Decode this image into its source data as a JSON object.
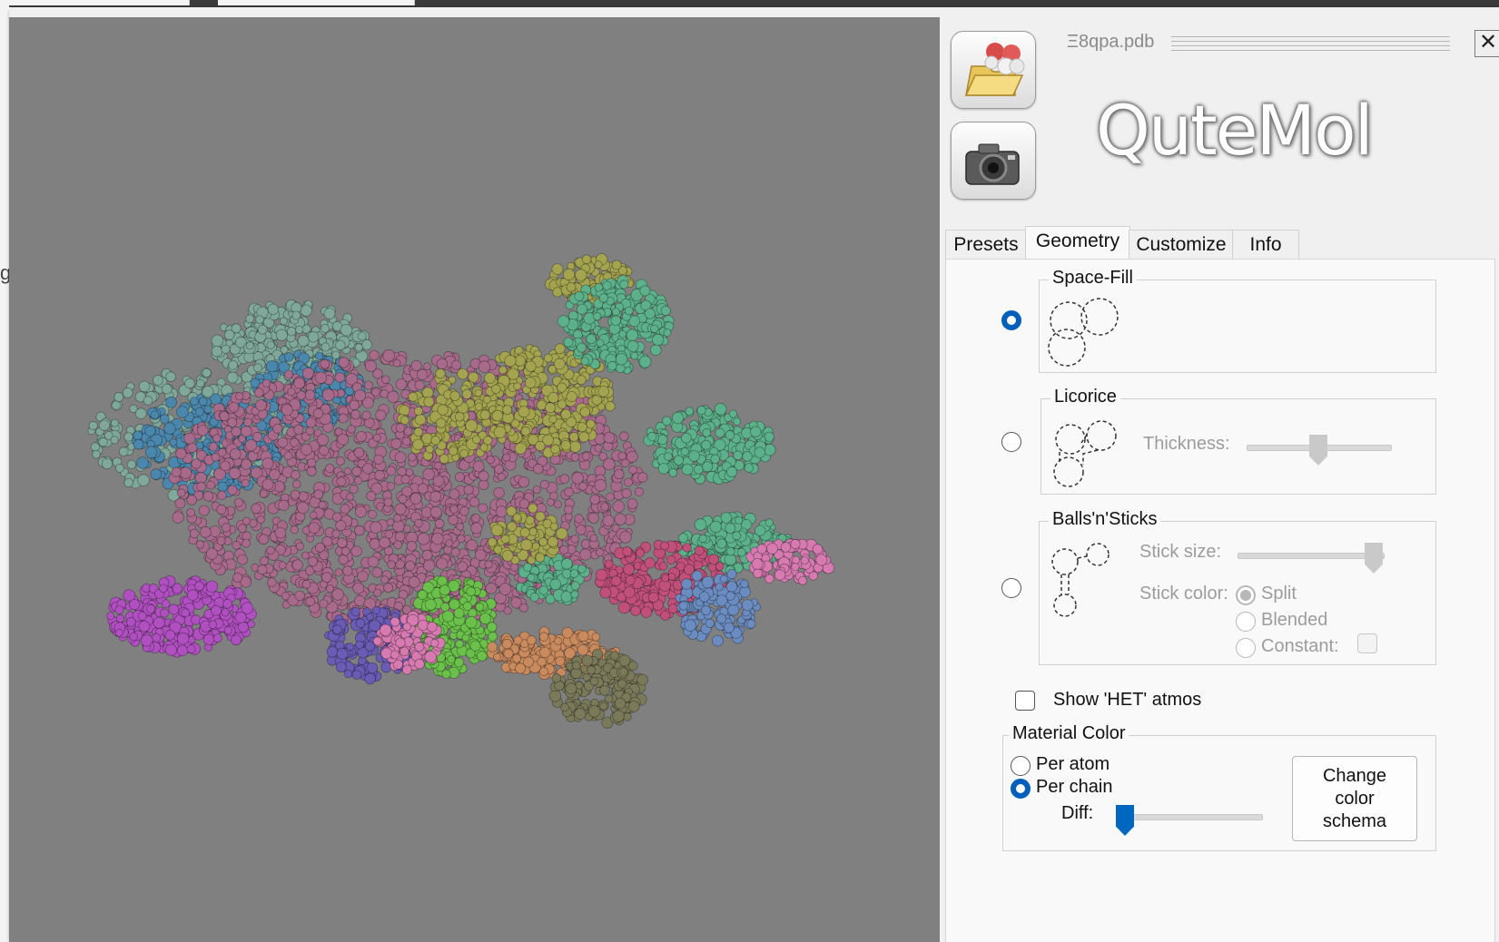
{
  "background": {
    "left_edge_char": "g"
  },
  "header": {
    "filename": "Ξ8qpa.pdb",
    "logo_text": "QuteMol",
    "close_glyph": "✕",
    "open_icon": "folder-molecule-icon",
    "snapshot_icon": "camera-icon"
  },
  "tabs": [
    {
      "label": "Presets"
    },
    {
      "label": "Geometry"
    },
    {
      "label": "Customize"
    },
    {
      "label": "Info"
    }
  ],
  "geometry": {
    "space_fill": {
      "title": "Space-Fill",
      "selected": true
    },
    "licorice": {
      "title": "Licorice",
      "selected": false,
      "thickness_label": "Thickness:",
      "thickness_value": 0.5
    },
    "balls_sticks": {
      "title": "Balls'n'Sticks",
      "selected": false,
      "stick_size_label": "Stick size:",
      "stick_size_value": 1.0,
      "stick_color_label": "Stick color:",
      "color_options": [
        "Split",
        "Blended",
        "Constant:"
      ],
      "selected_color_option": "Split"
    },
    "show_het_label": "Show 'HET' atmos",
    "show_het_checked": false,
    "material_color": {
      "title": "Material Color",
      "options": [
        "Per atom",
        "Per chain"
      ],
      "selected": "Per chain",
      "diff_label": "Diff:",
      "diff_value": 0.0,
      "change_button": "Change\ncolor\nschema"
    }
  },
  "colors": {
    "viewport_bg": "#808080",
    "accent": "#005fb8",
    "chain_colors": [
      "#a86a8a",
      "#7fa89a",
      "#4b87ad",
      "#a3a350",
      "#5cb08a",
      "#b04fc0",
      "#6a5bb5",
      "#6ac04a",
      "#c98a5e",
      "#7a7a5a",
      "#d67ab0",
      "#6a8cc0",
      "#c0507a"
    ]
  }
}
